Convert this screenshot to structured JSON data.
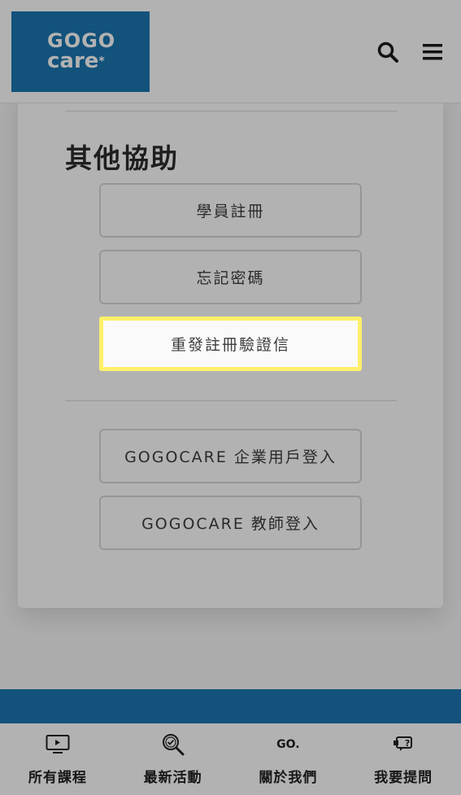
{
  "header": {
    "logo_line1": "GOGO",
    "logo_line2": "care",
    "logo_mark": "*",
    "search_icon": "search-icon",
    "menu_icon": "menu-icon"
  },
  "help": {
    "title": "其他協助",
    "buttons": [
      {
        "label": "學員註冊"
      },
      {
        "label": "忘記密碼"
      },
      {
        "label": "重發註冊驗證信"
      }
    ],
    "login_buttons": [
      {
        "label": "GOGOCARE 企業用戶登入"
      },
      {
        "label": "GOGOCARE 教師登入"
      }
    ]
  },
  "tabbar": {
    "items": [
      {
        "label": "所有課程",
        "icon": "video-icon"
      },
      {
        "label": "最新活動",
        "icon": "search-check-icon"
      },
      {
        "label": "關於我們",
        "icon": "go-icon",
        "icon_text": "GO."
      },
      {
        "label": "我要提問",
        "icon": "question-chat-icon",
        "icon_text": "?"
      }
    ]
  },
  "colors": {
    "brand_blue": "#1b76b0",
    "highlight_yellow": "#fff06a"
  }
}
